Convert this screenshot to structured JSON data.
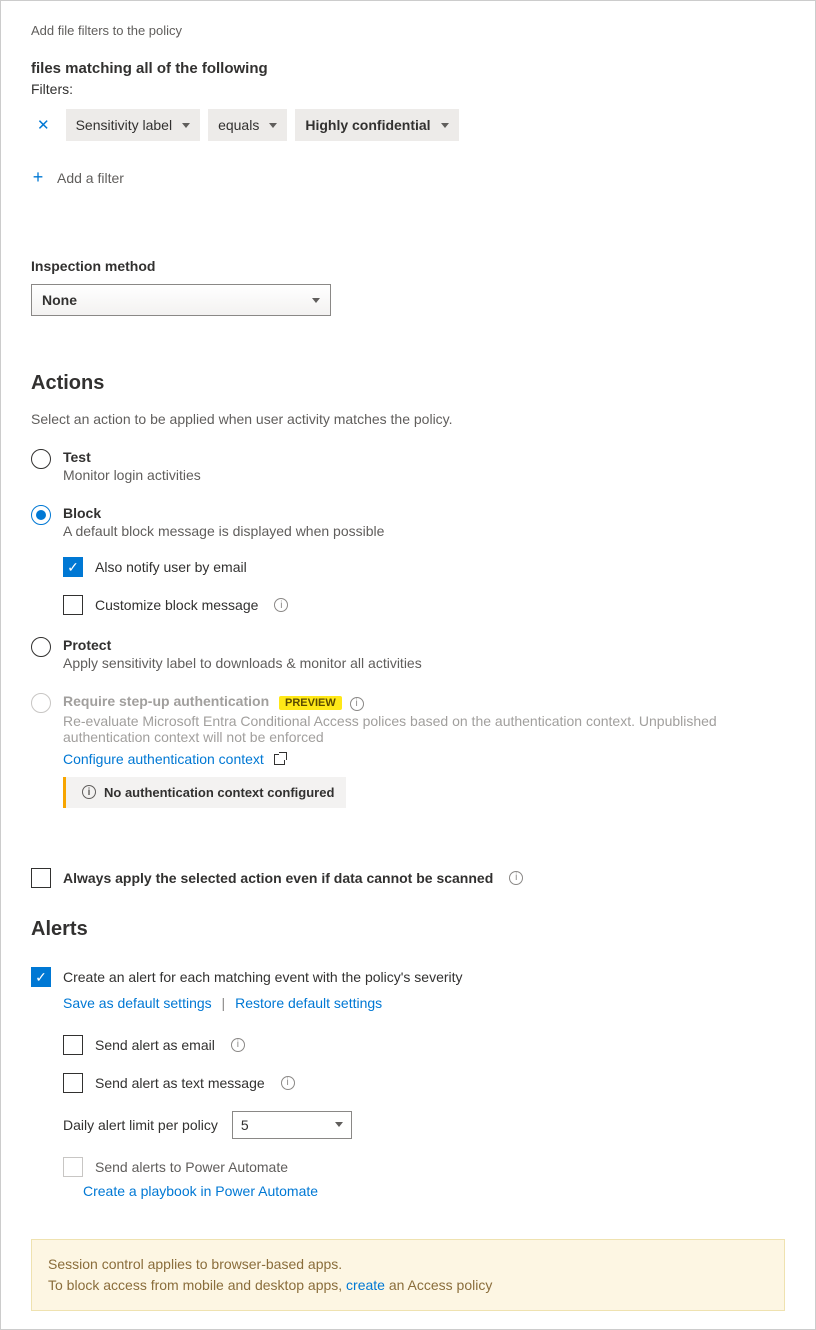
{
  "filters": {
    "intro": "Add file filters to the policy",
    "match_heading": "files matching all of the following",
    "filters_label": "Filters:",
    "row": {
      "field": "Sensitivity label",
      "op": "equals",
      "value": "Highly confidential"
    },
    "add_filter": "Add a filter"
  },
  "inspection": {
    "label": "Inspection method",
    "value": "None"
  },
  "actions": {
    "heading": "Actions",
    "desc": "Select an action to be applied when user activity matches the policy.",
    "test": {
      "label": "Test",
      "sub": "Monitor login activities"
    },
    "block": {
      "label": "Block",
      "sub": "A default block message is displayed when possible",
      "notify_email": "Also notify user by email",
      "customize": "Customize block message"
    },
    "protect": {
      "label": "Protect",
      "sub": "Apply sensitivity label to downloads & monitor all activities"
    },
    "stepup": {
      "label": "Require step-up authentication",
      "preview": "PREVIEW",
      "sub": "Re-evaluate Microsoft Entra Conditional Access polices based on the authentication context. Unpublished authentication context will not be enforced",
      "configure": "Configure authentication context",
      "warn": "No authentication context configured"
    },
    "always_apply": "Always apply the selected action even if data cannot be scanned"
  },
  "alerts": {
    "heading": "Alerts",
    "create": "Create an alert for each matching event with the policy's severity",
    "save_default": "Save as default settings",
    "restore_default": "Restore default settings",
    "send_email": "Send alert as email",
    "send_text": "Send alert as text message",
    "daily_limit_label": "Daily alert limit per policy",
    "daily_limit_value": "5",
    "send_power_automate": "Send alerts to Power Automate",
    "create_playbook": "Create a playbook in Power Automate"
  },
  "footer": {
    "line1": "Session control applies to browser-based apps.",
    "line2a": "To block access from mobile and desktop apps, ",
    "link": "create",
    "line2b": " an Access policy"
  }
}
